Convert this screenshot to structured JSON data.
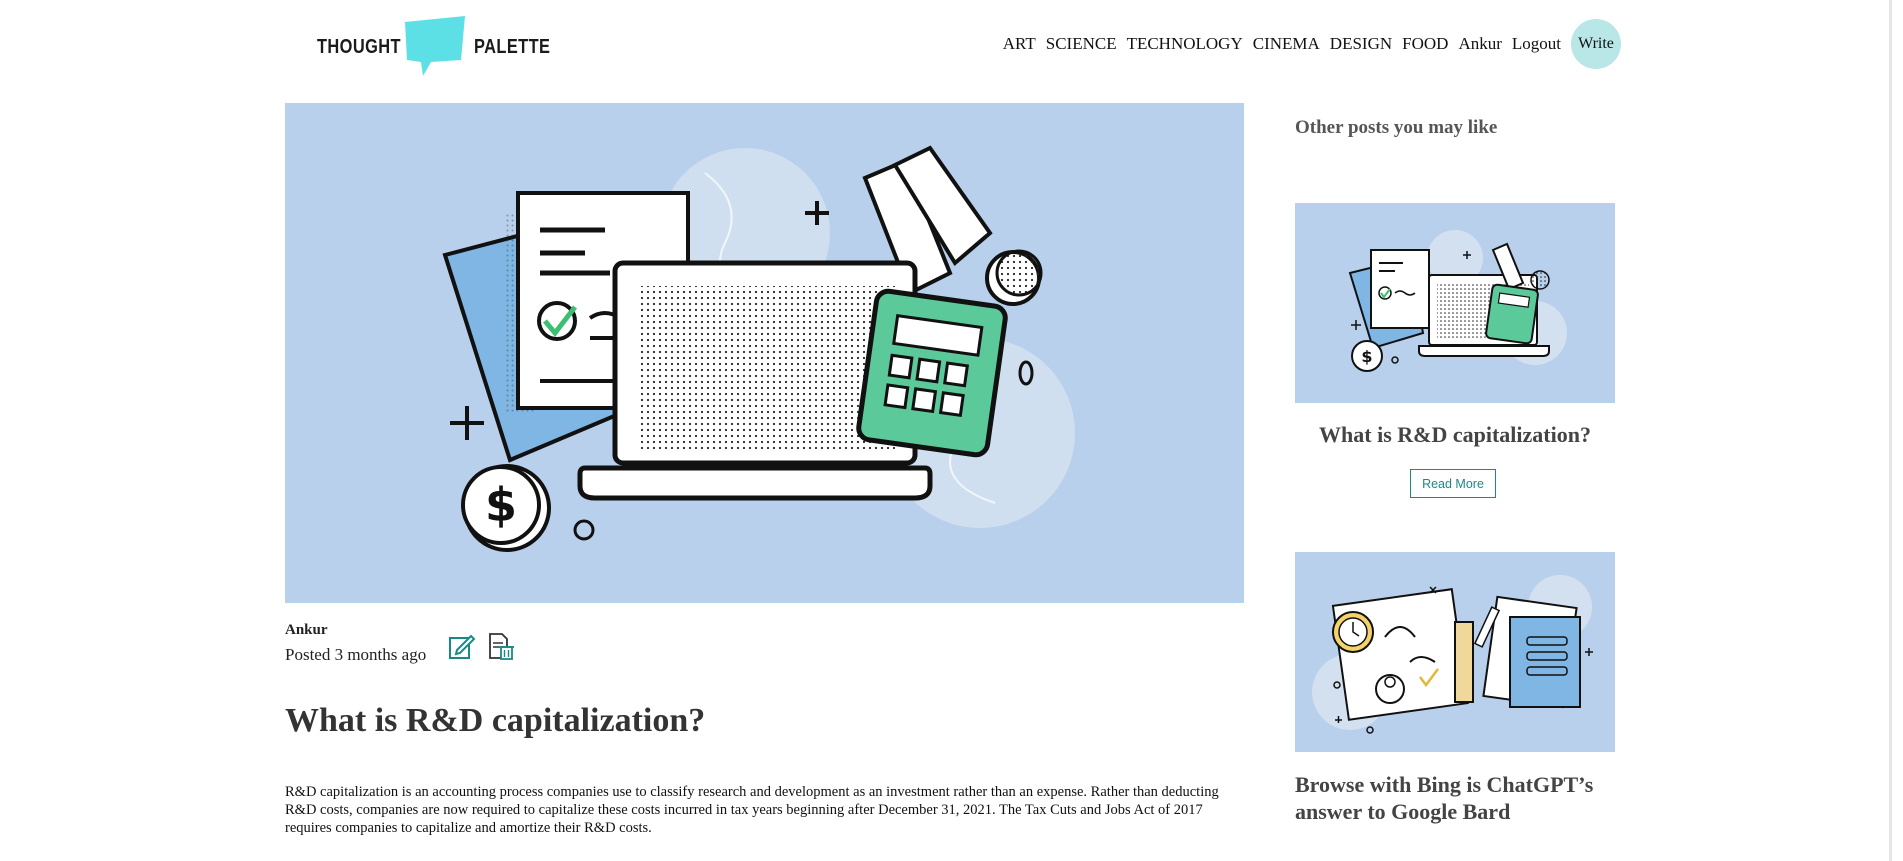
{
  "logo": {
    "word_left": "THOUGHT",
    "word_right": "PALETTE",
    "accent": "#5ce0e6"
  },
  "nav": {
    "items": [
      "ART",
      "SCIENCE",
      "TECHNOLOGY",
      "CINEMA",
      "DESIGN",
      "FOOD",
      "Ankur",
      "Logout"
    ],
    "write_label": "Write"
  },
  "post": {
    "author": "Ankur",
    "posted_label": "Posted 3 months ago",
    "title": "What is R&D capitalization?",
    "body": "R&D capitalization is an accounting process companies use to classify research and development as an investment rather than an expense. Rather than deducting R&D costs, companies are now required to capitalize these costs incurred in tax years beginning after December 31, 2021. The Tax Cuts and Jobs Act of 2017 requires companies to capitalize and amortize their R&D costs."
  },
  "sidebar": {
    "heading": "Other posts you may like",
    "cards": [
      {
        "title": "What is R&D capitalization?",
        "read_more": "Read More"
      },
      {
        "title": "Browse with Bing is ChatGPT’s answer to Google Bard"
      }
    ]
  },
  "colors": {
    "hero_bg": "#b8d0ec",
    "write_bg": "#b9e6e6",
    "accent_teal": "#1a8a85",
    "calculator": "#5cc99a"
  }
}
